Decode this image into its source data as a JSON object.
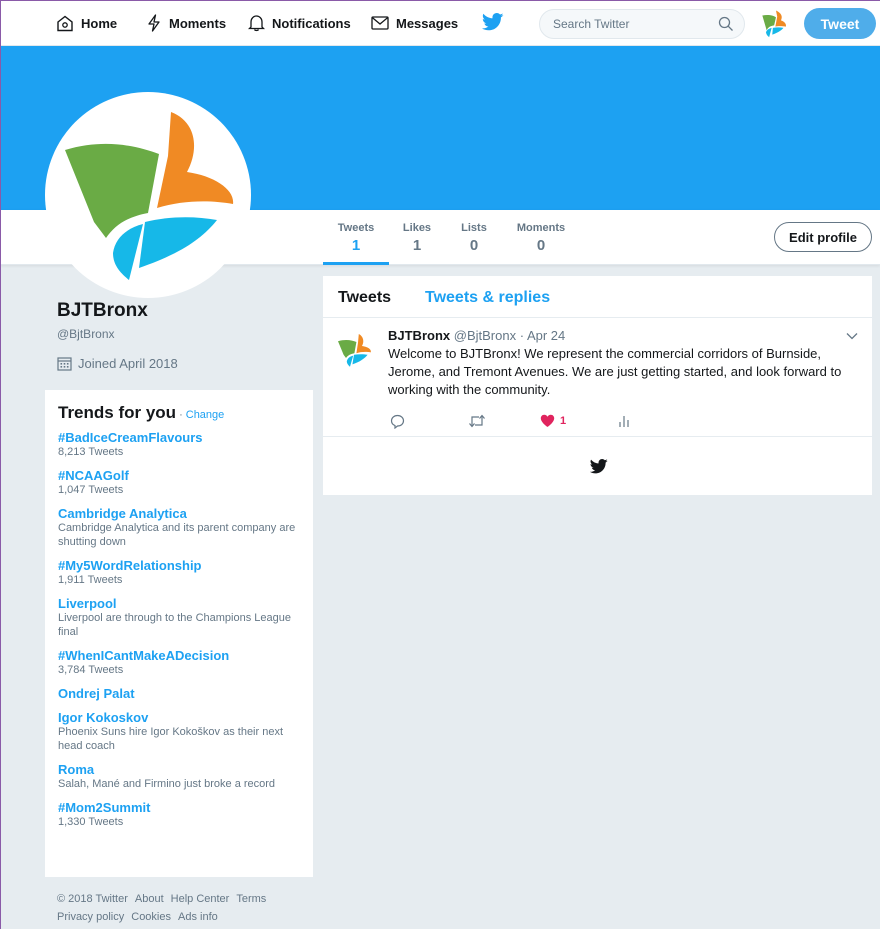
{
  "nav": {
    "home": "Home",
    "moments": "Moments",
    "notifications": "Notifications",
    "messages": "Messages",
    "search_placeholder": "Search Twitter",
    "tweet_button": "Tweet"
  },
  "profile": {
    "name": "BJTBronx",
    "handle": "@BjtBronx",
    "joined": "Joined April 2018",
    "edit_button": "Edit profile"
  },
  "stats": [
    {
      "label": "Tweets",
      "value": "1"
    },
    {
      "label": "Likes",
      "value": "1"
    },
    {
      "label": "Lists",
      "value": "0"
    },
    {
      "label": "Moments",
      "value": "0"
    }
  ],
  "trends": {
    "title": "Trends for you",
    "separator": "·",
    "change": "Change",
    "items": [
      {
        "name": "#BadIceCreamFlavours",
        "meta": "8,213 Tweets"
      },
      {
        "name": "#NCAAGolf",
        "meta": "1,047 Tweets"
      },
      {
        "name": "Cambridge Analytica",
        "meta": "Cambridge Analytica and its parent company are shutting down"
      },
      {
        "name": "#My5WordRelationship",
        "meta": "1,911 Tweets"
      },
      {
        "name": "Liverpool",
        "meta": "Liverpool are through to the Champions League final"
      },
      {
        "name": "#WhenICantMakeADecision",
        "meta": "3,784 Tweets"
      },
      {
        "name": "Ondrej Palat",
        "meta": ""
      },
      {
        "name": "Igor Kokoskov",
        "meta": "Phoenix Suns hire Igor Kokoškov as their next head coach"
      },
      {
        "name": "Roma",
        "meta": "Salah, Mané and Firmino just broke a record"
      },
      {
        "name": "#Mom2Summit",
        "meta": "1,330 Tweets"
      }
    ]
  },
  "footer": {
    "links": [
      "© 2018 Twitter",
      "About",
      "Help Center",
      "Terms",
      "Privacy policy",
      "Cookies",
      "Ads info"
    ]
  },
  "timeline": {
    "tab_tweets": "Tweets",
    "tab_replies": "Tweets & replies",
    "tweet": {
      "author": "BJTBronx",
      "handle": "@BjtBronx",
      "sep": "·",
      "date": "Apr 24",
      "text": "Welcome to BJTBronx! We represent the commercial corridors of Burnside, Jerome, and Tremont Avenues. We are just getting started, and look forward to working with the community.",
      "like_count": "1"
    }
  },
  "colors": {
    "accent": "#1da1f2",
    "like": "#e0245e",
    "logo_green": "#6aab45",
    "logo_orange": "#f08a24",
    "logo_blue": "#16b8e8"
  }
}
